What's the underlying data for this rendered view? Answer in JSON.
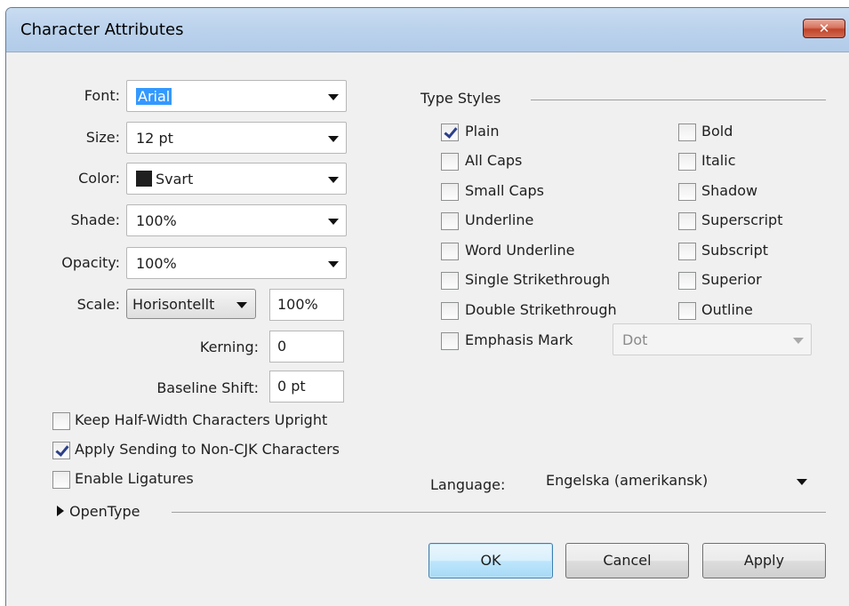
{
  "window": {
    "title": "Character Attributes",
    "close_glyph": "✕"
  },
  "fields": {
    "font": {
      "label": "Font:",
      "value": "Arial"
    },
    "size": {
      "label": "Size:",
      "value": "12 pt"
    },
    "color": {
      "label": "Color:",
      "value": "Svart",
      "swatch": "#1f1f1f"
    },
    "shade": {
      "label": "Shade:",
      "value": "100%"
    },
    "opacity": {
      "label": "Opacity:",
      "value": "100%"
    },
    "scale": {
      "label": "Scale:",
      "mode": "Horisontellt",
      "value": "100%"
    },
    "kerning": {
      "label": "Kerning:",
      "value": "0"
    },
    "baseline_shift": {
      "label": "Baseline Shift:",
      "value": "0 pt"
    }
  },
  "type_styles": {
    "heading": "Type Styles",
    "left": [
      {
        "label": "Plain",
        "checked": true
      },
      {
        "label": "All Caps",
        "checked": false
      },
      {
        "label": "Small Caps",
        "checked": false
      },
      {
        "label": "Underline",
        "checked": false
      },
      {
        "label": "Word Underline",
        "checked": false
      },
      {
        "label": "Single Strikethrough",
        "checked": false
      },
      {
        "label": "Double Strikethrough",
        "checked": false
      },
      {
        "label": "Emphasis Mark",
        "checked": false
      }
    ],
    "right": [
      {
        "label": "Bold",
        "checked": false
      },
      {
        "label": "Italic",
        "checked": false
      },
      {
        "label": "Shadow",
        "checked": false
      },
      {
        "label": "Superscript",
        "checked": false
      },
      {
        "label": "Subscript",
        "checked": false
      },
      {
        "label": "Superior",
        "checked": false
      },
      {
        "label": "Outline",
        "checked": false
      }
    ],
    "emphasis_select": "Dot"
  },
  "options": [
    {
      "label": "Keep Half-Width Characters Upright",
      "checked": false
    },
    {
      "label": "Apply Sending to Non-CJK Characters",
      "checked": true
    },
    {
      "label": "Enable Ligatures",
      "checked": false
    }
  ],
  "language": {
    "label": "Language:",
    "value": "Engelska (amerikansk)"
  },
  "opentype": {
    "label": "OpenType",
    "expanded": false
  },
  "buttons": {
    "ok": "OK",
    "cancel": "Cancel",
    "apply": "Apply"
  },
  "colors": {
    "selection": "#3399ff",
    "default_button_border": "#3c7fb1",
    "close_button": "#c04428"
  }
}
